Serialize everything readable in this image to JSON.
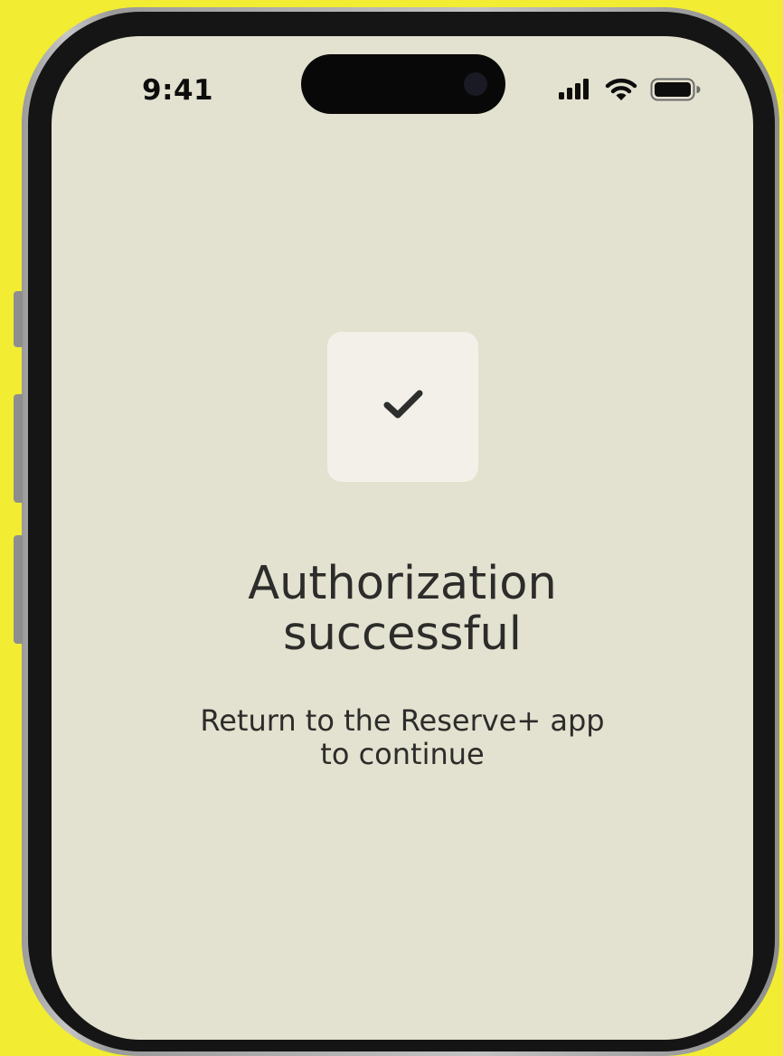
{
  "background": "#f2ec33",
  "status_bar": {
    "time": "9:41",
    "icons": [
      "cellular-signal-icon",
      "wifi-icon",
      "battery-icon"
    ]
  },
  "screen": {
    "background": "#e3e1cf",
    "check_icon": "checkmark-icon",
    "title": "Authorization\nsuccessful",
    "subtitle": "Return to the Reserve+ app\nto continue"
  }
}
